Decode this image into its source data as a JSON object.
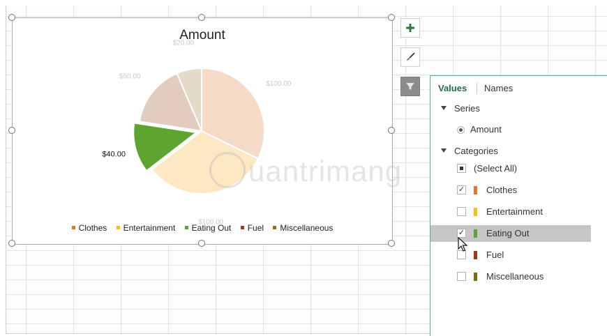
{
  "chart": {
    "title": "Amount"
  },
  "chart_data": {
    "type": "pie",
    "title": "Amount",
    "categories": [
      "Clothes",
      "Entertainment",
      "Eating Out",
      "Fuel",
      "Miscellaneous"
    ],
    "values": [
      100,
      100,
      40,
      50,
      20
    ],
    "value_labels": [
      "$100.00",
      "$100.00",
      "$40.00",
      "$50.00",
      "$20.00"
    ],
    "colors": [
      "#f5dac8",
      "#fce8c3",
      "#5ea52f",
      "#e2cbbf",
      "#e4dac8"
    ],
    "highlighted": "Eating Out",
    "legend_position": "bottom"
  },
  "legend": {
    "items": [
      {
        "label": "Clothes",
        "color": "#e0772c"
      },
      {
        "label": "Entertainment",
        "color": "#f2c018"
      },
      {
        "label": "Eating Out",
        "color": "#5ea52f"
      },
      {
        "label": "Fuel",
        "color": "#a33818"
      },
      {
        "label": "Miscellaneous",
        "color": "#9a6a1a"
      }
    ]
  },
  "side_buttons": {
    "plus_icon": "plus-icon",
    "brush_icon": "brush-icon",
    "filter_icon": "filter-icon"
  },
  "filter_panel": {
    "tabs": [
      "Values",
      "Names"
    ],
    "series_heading": "Series",
    "series_item": "Amount",
    "categories_heading": "Categories",
    "select_all": "(Select All)",
    "categories": [
      {
        "label": "Clothes",
        "color": "#e0772c",
        "checked": true
      },
      {
        "label": "Entertainment",
        "color": "#f2c018",
        "checked": false
      },
      {
        "label": "Eating Out",
        "color": "#5ea52f",
        "checked": true
      },
      {
        "label": "Fuel",
        "color": "#a33818",
        "checked": false
      },
      {
        "label": "Miscellaneous",
        "color": "#7a6a10",
        "checked": false
      }
    ]
  },
  "watermark": {
    "text": "uantrimang"
  }
}
